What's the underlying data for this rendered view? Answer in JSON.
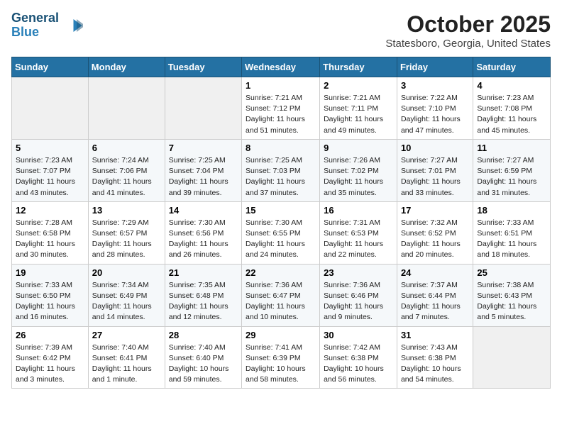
{
  "header": {
    "logo_line1": "General",
    "logo_line2": "Blue",
    "month": "October 2025",
    "location": "Statesboro, Georgia, United States"
  },
  "days_of_week": [
    "Sunday",
    "Monday",
    "Tuesday",
    "Wednesday",
    "Thursday",
    "Friday",
    "Saturday"
  ],
  "weeks": [
    [
      {
        "day": "",
        "empty": true
      },
      {
        "day": "",
        "empty": true
      },
      {
        "day": "",
        "empty": true
      },
      {
        "day": "1",
        "sunrise": "7:21 AM",
        "sunset": "7:12 PM",
        "daylight": "11 hours and 51 minutes."
      },
      {
        "day": "2",
        "sunrise": "7:21 AM",
        "sunset": "7:11 PM",
        "daylight": "11 hours and 49 minutes."
      },
      {
        "day": "3",
        "sunrise": "7:22 AM",
        "sunset": "7:10 PM",
        "daylight": "11 hours and 47 minutes."
      },
      {
        "day": "4",
        "sunrise": "7:23 AM",
        "sunset": "7:08 PM",
        "daylight": "11 hours and 45 minutes."
      }
    ],
    [
      {
        "day": "5",
        "sunrise": "7:23 AM",
        "sunset": "7:07 PM",
        "daylight": "11 hours and 43 minutes."
      },
      {
        "day": "6",
        "sunrise": "7:24 AM",
        "sunset": "7:06 PM",
        "daylight": "11 hours and 41 minutes."
      },
      {
        "day": "7",
        "sunrise": "7:25 AM",
        "sunset": "7:04 PM",
        "daylight": "11 hours and 39 minutes."
      },
      {
        "day": "8",
        "sunrise": "7:25 AM",
        "sunset": "7:03 PM",
        "daylight": "11 hours and 37 minutes."
      },
      {
        "day": "9",
        "sunrise": "7:26 AM",
        "sunset": "7:02 PM",
        "daylight": "11 hours and 35 minutes."
      },
      {
        "day": "10",
        "sunrise": "7:27 AM",
        "sunset": "7:01 PM",
        "daylight": "11 hours and 33 minutes."
      },
      {
        "day": "11",
        "sunrise": "7:27 AM",
        "sunset": "6:59 PM",
        "daylight": "11 hours and 31 minutes."
      }
    ],
    [
      {
        "day": "12",
        "sunrise": "7:28 AM",
        "sunset": "6:58 PM",
        "daylight": "11 hours and 30 minutes."
      },
      {
        "day": "13",
        "sunrise": "7:29 AM",
        "sunset": "6:57 PM",
        "daylight": "11 hours and 28 minutes."
      },
      {
        "day": "14",
        "sunrise": "7:30 AM",
        "sunset": "6:56 PM",
        "daylight": "11 hours and 26 minutes."
      },
      {
        "day": "15",
        "sunrise": "7:30 AM",
        "sunset": "6:55 PM",
        "daylight": "11 hours and 24 minutes."
      },
      {
        "day": "16",
        "sunrise": "7:31 AM",
        "sunset": "6:53 PM",
        "daylight": "11 hours and 22 minutes."
      },
      {
        "day": "17",
        "sunrise": "7:32 AM",
        "sunset": "6:52 PM",
        "daylight": "11 hours and 20 minutes."
      },
      {
        "day": "18",
        "sunrise": "7:33 AM",
        "sunset": "6:51 PM",
        "daylight": "11 hours and 18 minutes."
      }
    ],
    [
      {
        "day": "19",
        "sunrise": "7:33 AM",
        "sunset": "6:50 PM",
        "daylight": "11 hours and 16 minutes."
      },
      {
        "day": "20",
        "sunrise": "7:34 AM",
        "sunset": "6:49 PM",
        "daylight": "11 hours and 14 minutes."
      },
      {
        "day": "21",
        "sunrise": "7:35 AM",
        "sunset": "6:48 PM",
        "daylight": "11 hours and 12 minutes."
      },
      {
        "day": "22",
        "sunrise": "7:36 AM",
        "sunset": "6:47 PM",
        "daylight": "11 hours and 10 minutes."
      },
      {
        "day": "23",
        "sunrise": "7:36 AM",
        "sunset": "6:46 PM",
        "daylight": "11 hours and 9 minutes."
      },
      {
        "day": "24",
        "sunrise": "7:37 AM",
        "sunset": "6:44 PM",
        "daylight": "11 hours and 7 minutes."
      },
      {
        "day": "25",
        "sunrise": "7:38 AM",
        "sunset": "6:43 PM",
        "daylight": "11 hours and 5 minutes."
      }
    ],
    [
      {
        "day": "26",
        "sunrise": "7:39 AM",
        "sunset": "6:42 PM",
        "daylight": "11 hours and 3 minutes."
      },
      {
        "day": "27",
        "sunrise": "7:40 AM",
        "sunset": "6:41 PM",
        "daylight": "11 hours and 1 minute."
      },
      {
        "day": "28",
        "sunrise": "7:40 AM",
        "sunset": "6:40 PM",
        "daylight": "10 hours and 59 minutes."
      },
      {
        "day": "29",
        "sunrise": "7:41 AM",
        "sunset": "6:39 PM",
        "daylight": "10 hours and 58 minutes."
      },
      {
        "day": "30",
        "sunrise": "7:42 AM",
        "sunset": "6:38 PM",
        "daylight": "10 hours and 56 minutes."
      },
      {
        "day": "31",
        "sunrise": "7:43 AM",
        "sunset": "6:38 PM",
        "daylight": "10 hours and 54 minutes."
      },
      {
        "day": "",
        "empty": true
      }
    ]
  ],
  "labels": {
    "sunrise_label": "Sunrise:",
    "sunset_label": "Sunset:",
    "daylight_label": "Daylight:"
  }
}
